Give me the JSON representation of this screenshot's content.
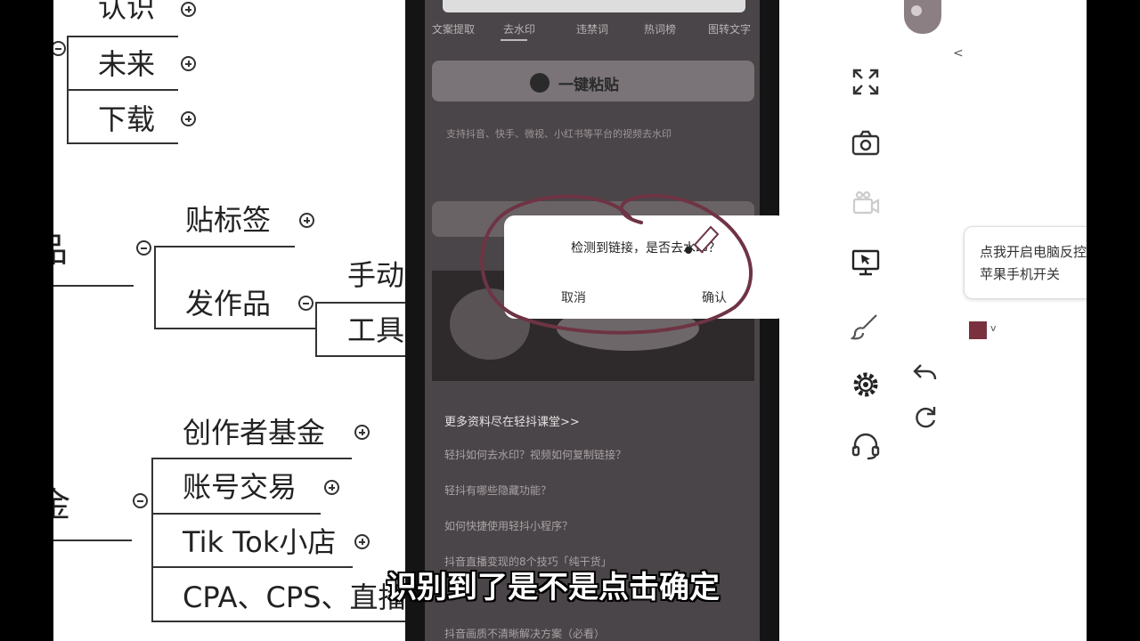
{
  "mindmap": {
    "top_items": [
      "认识",
      "未来",
      "下载"
    ],
    "works_branch": {
      "label": "作品",
      "children": [
        "贴标签",
        "发作品"
      ],
      "publish_children": [
        "手动",
        "工具"
      ]
    },
    "money_branch": {
      "label": "变现金",
      "children": [
        "创作者基金",
        "账号交易",
        "Tik Tok小店",
        "CPA、CPS、直播打赏"
      ]
    }
  },
  "phone": {
    "tabs": [
      "文案提取",
      "去水印",
      "违禁词",
      "热词榜",
      "图转文字"
    ],
    "banner_text": "一键粘贴",
    "description": "支持抖音、快手、微视、小红书等平台的视频去水印",
    "link_title": "更多资料尽在轻抖课堂>>",
    "links": [
      "轻抖如何去水印？视频如何复制链接？",
      "轻抖有哪些隐藏功能？",
      "如何快捷使用轻抖小程序？",
      "抖音直播变现的8个技巧「纯干货」",
      "抖音画质不清晰解决方案（必看）"
    ],
    "dialog": {
      "message": "检测到链接，是否去水印？",
      "cancel": "取消",
      "confirm": "确认"
    }
  },
  "sidebar": {
    "tooltip_line1": "点我开启电脑反控",
    "tooltip_line2": "苹果手机开关",
    "pen_color": "#7b3040"
  },
  "subtitle": "识别到了是不是点击确定"
}
